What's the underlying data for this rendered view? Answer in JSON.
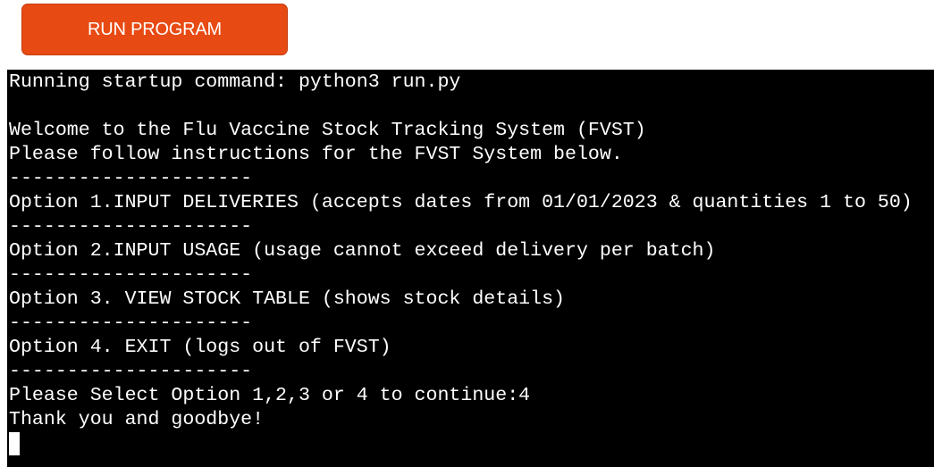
{
  "toolbar": {
    "run_label": "RUN PROGRAM"
  },
  "terminal": {
    "lines": [
      "Running startup command: python3 run.py",
      "",
      "Welcome to the Flu Vaccine Stock Tracking System (FVST)",
      "Please follow instructions for the FVST System below.",
      "---------------------",
      "Option 1.INPUT DELIVERIES (accepts dates from 01/01/2023 & quantities 1 to 50)",
      "---------------------",
      "Option 2.INPUT USAGE (usage cannot exceed delivery per batch)",
      "---------------------",
      "Option 3. VIEW STOCK TABLE (shows stock details)",
      "---------------------",
      "Option 4. EXIT (logs out of FVST)",
      "---------------------",
      "Please Select Option 1,2,3 or 4 to continue:4",
      "Thank you and goodbye!"
    ]
  },
  "colors": {
    "button_bg": "#e84a13",
    "terminal_bg": "#000000",
    "terminal_fg": "#ffffff"
  }
}
